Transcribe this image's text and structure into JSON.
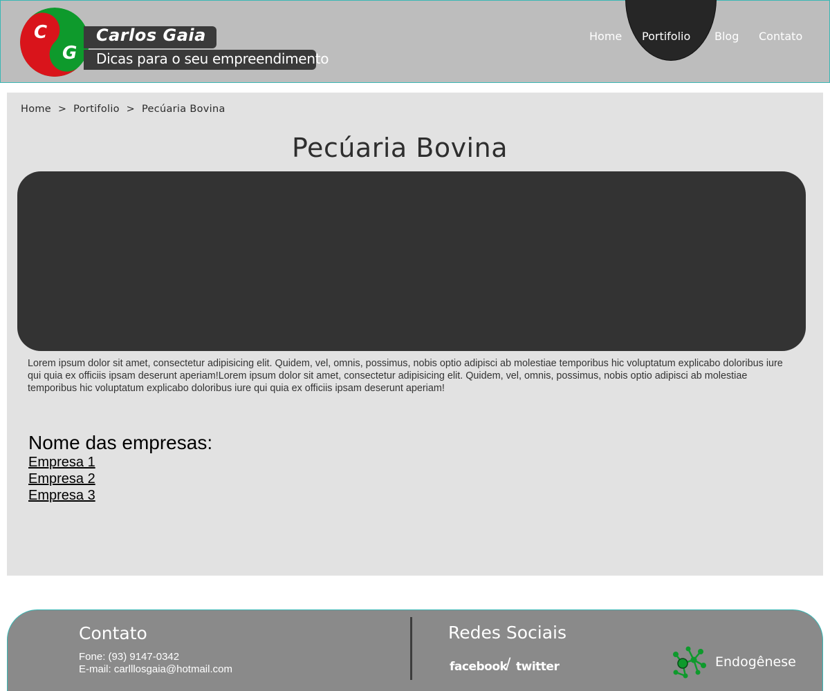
{
  "header": {
    "logo_letters": [
      "C",
      "G"
    ],
    "brand_name": "Carlos Gaia",
    "tagline": "Dicas para o seu empreendimento",
    "nav": [
      {
        "label": "Home"
      },
      {
        "label": "Portifolio",
        "active": true
      },
      {
        "label": "Blog"
      },
      {
        "label": "Contato"
      }
    ]
  },
  "breadcrumb": {
    "items": [
      "Home",
      "Portifolio",
      "Pecúaria Bovina"
    ],
    "separator": ">"
  },
  "main": {
    "title": "Pecúaria Bovina",
    "body_text": "Lorem ipsum dolor sit amet, consectetur adipisicing elit. Quidem, vel, omnis, possimus, nobis optio adipisci ab molestiae temporibus hic voluptatum explicabo doloribus iure qui quia ex officiis ipsam deserunt aperiam!Lorem ipsum dolor sit amet, consectetur adipisicing elit. Quidem, vel, omnis, possimus, nobis optio adipisci ab molestiae temporibus hic voluptatum explicabo doloribus iure qui quia ex officiis ipsam deserunt aperiam!",
    "companies_title": "Nome das empresas:",
    "companies": [
      "Empresa 1",
      "Empresa 2",
      "Empresa 3"
    ]
  },
  "footer": {
    "contact_title": "Contato",
    "phone": "Fone: (93) 9147-0342",
    "email": "E-mail: carlllosgaia@hotmail.com",
    "social_title": "Redes Sociais",
    "facebook": "facebook",
    "separator": "/",
    "twitter": "twitter",
    "credit": "Endogênese"
  },
  "colors": {
    "header_bg": "#bdbdbd",
    "header_border": "#39b7b4",
    "nav_active": "#262626",
    "panel_bg": "#e2e2e2",
    "hero_bg": "#333333",
    "footer_bg": "#8a8a8a",
    "logo_red": "#d9141b",
    "logo_green": "#0e9a2c"
  },
  "icons": {
    "logo": "cg-yin-yang-logo",
    "credit": "molecule-icon"
  }
}
